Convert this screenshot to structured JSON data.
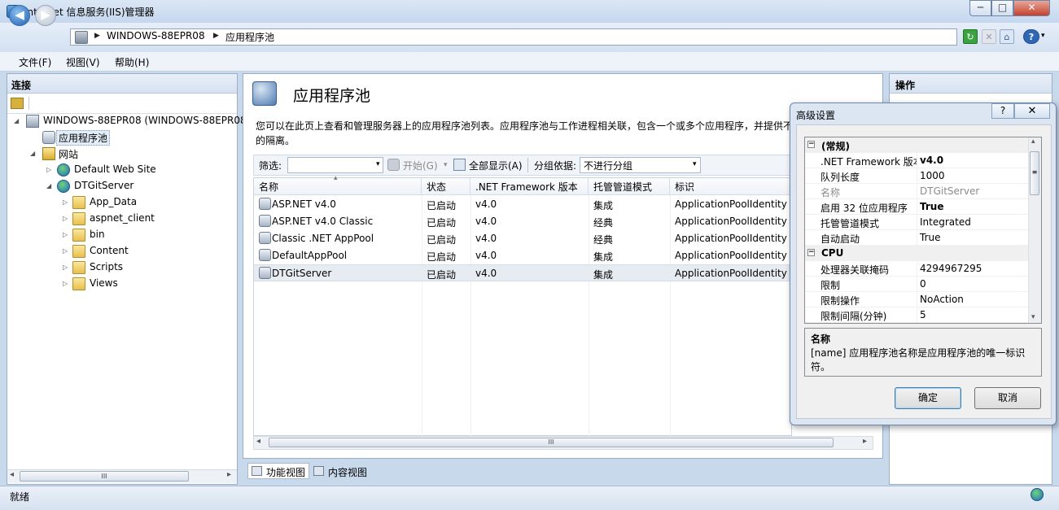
{
  "window": {
    "title": "Internet 信息服务(IIS)管理器",
    "min": "─",
    "max": "□",
    "close": "✕"
  },
  "nav": {
    "back": "◀",
    "forward": "▶",
    "crumb_arrow": "▶",
    "breadcrumbs": [
      "WINDOWS-88EPR08",
      "应用程序池"
    ],
    "refresh": "↻",
    "stop": "✕",
    "home": "⌂",
    "help": "?",
    "drop": "▾"
  },
  "menu": [
    "文件(F)",
    "视图(V)",
    "帮助(H)"
  ],
  "connections": {
    "title": "连接",
    "tree": {
      "expanded": "◢",
      "collapsed": "▷",
      "server": "WINDOWS-88EPR08 (WINDOWS-88EPR08",
      "app_pools": "应用程序池",
      "sites": "网站",
      "site_items": [
        "Default Web Site",
        "DTGitServer"
      ],
      "folders": [
        "App_Data",
        "aspnet_client",
        "bin",
        "Content",
        "Scripts",
        "Views"
      ]
    },
    "scroll": {
      "left": "◂",
      "right": "▸",
      "grip": "III"
    }
  },
  "center": {
    "title": "应用程序池",
    "description": "您可以在此页上查看和管理服务器上的应用程序池列表。应用程序池与工作进程相关联，包含一个或多个应用程序，并提供不 的隔离。",
    "filter": {
      "label": "筛选:",
      "drop": "▾",
      "start": "开始(G)",
      "show_all": "全部显示(A)",
      "group_label": "分组依据:",
      "group_value": "不进行分组"
    },
    "columns": [
      "名称",
      "状态",
      ".NET Framework 版本",
      "托管管道模式",
      "标识"
    ],
    "sort_mark": "▴",
    "rows": [
      {
        "name": "ASP.NET v4.0",
        "status": "已启动",
        "version": "v4.0",
        "mode": "集成",
        "identity": "ApplicationPoolIdentity"
      },
      {
        "name": "ASP.NET v4.0 Classic",
        "status": "已启动",
        "version": "v4.0",
        "mode": "经典",
        "identity": "ApplicationPoolIdentity"
      },
      {
        "name": "Classic .NET AppPool",
        "status": "已启动",
        "version": "v4.0",
        "mode": "经典",
        "identity": "ApplicationPoolIdentity"
      },
      {
        "name": "DefaultAppPool",
        "status": "已启动",
        "version": "v4.0",
        "mode": "集成",
        "identity": "ApplicationPoolIdentity"
      },
      {
        "name": "DTGitServer",
        "status": "已启动",
        "version": "v4.0",
        "mode": "集成",
        "identity": "ApplicationPoolIdentity"
      }
    ],
    "scroll": {
      "left": "◂",
      "right": "▸",
      "grip": "III"
    },
    "tabs": {
      "features": "功能视图",
      "content": "内容视图"
    }
  },
  "actions": {
    "title": "操作"
  },
  "dialog": {
    "title": "高级设置",
    "help": "?",
    "close": "✕",
    "toggle": "−",
    "categories": [
      "(常规)",
      "CPU"
    ],
    "general": [
      {
        "key": ".NET Framework 版本",
        "value": "v4.0"
      },
      {
        "key": "队列长度",
        "value": "1000"
      },
      {
        "key": "名称",
        "value": "DTGitServer"
      },
      {
        "key": "启用 32 位应用程序",
        "value": "True"
      },
      {
        "key": "托管管道模式",
        "value": "Integrated"
      },
      {
        "key": "自动启动",
        "value": "True"
      }
    ],
    "cpu": [
      {
        "key": "处理器关联掩码",
        "value": "4294967295"
      },
      {
        "key": "限制",
        "value": "0"
      },
      {
        "key": "限制操作",
        "value": "NoAction"
      },
      {
        "key": "限制间隔(分钟)",
        "value": "5"
      }
    ],
    "scroll": {
      "up": "▴",
      "down": "▾",
      "grip": "≡"
    },
    "desc_title": "名称",
    "desc_text": "[name] 应用程序池名称是应用程序池的唯一标识符。",
    "ok": "确定",
    "cancel": "取消"
  },
  "status": {
    "text": "就绪"
  }
}
